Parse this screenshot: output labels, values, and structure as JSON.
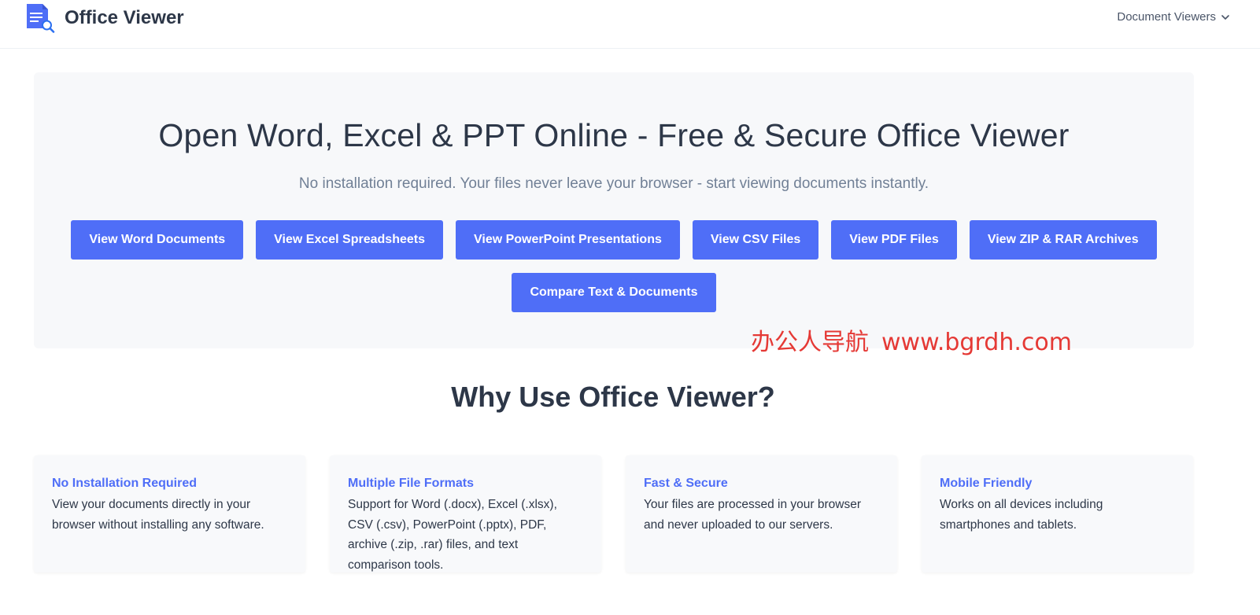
{
  "header": {
    "brand": "Office Viewer",
    "logo_icon": "document-search-icon",
    "nav_menu_label": "Document Viewers",
    "nav_menu_icon": "chevron-down-icon"
  },
  "hero": {
    "title": "Open Word, Excel & PPT Online - Free & Secure Office Viewer",
    "subtitle": "No installation required. Your files never leave your browser - start viewing documents instantly.",
    "buttons": [
      {
        "label": "View Word Documents"
      },
      {
        "label": "View Excel Spreadsheets"
      },
      {
        "label": "View PowerPoint Presentations"
      },
      {
        "label": "View CSV Files"
      },
      {
        "label": "View PDF Files"
      },
      {
        "label": "View ZIP & RAR Archives"
      },
      {
        "label": "Compare Text & Documents"
      }
    ]
  },
  "watermark": {
    "text_cn": "办公人导航",
    "url": "www.bgrdh.com"
  },
  "features": {
    "title": "Why Use Office Viewer?",
    "cards": [
      {
        "title": "No Installation Required",
        "text": "View your documents directly in your browser without installing any software."
      },
      {
        "title": "Multiple File Formats",
        "text": "Support for Word (.docx), Excel (.xlsx), CSV (.csv), PowerPoint (.pptx), PDF, archive (.zip, .rar) files, and text comparison tools."
      },
      {
        "title": "Fast & Secure",
        "text": "Your files are processed in your browser and never uploaded to our servers."
      },
      {
        "title": "Mobile Friendly",
        "text": "Works on all devices including smartphones and tablets."
      }
    ]
  },
  "colors": {
    "accent": "#4f6ef7",
    "text_dark": "#2d3748",
    "text_muted": "#718096",
    "hero_bg": "#f7f8fa",
    "watermark": "#e53935"
  }
}
